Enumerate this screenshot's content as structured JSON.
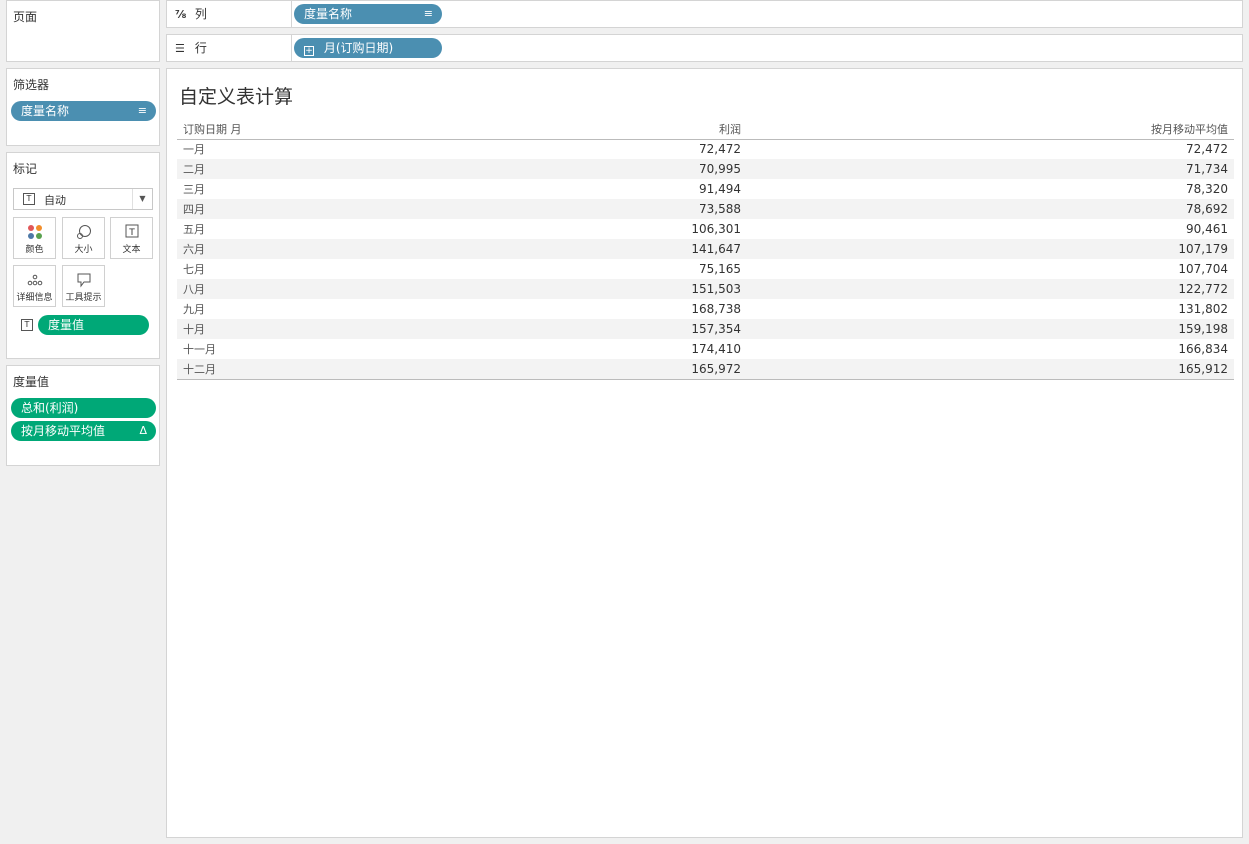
{
  "pages": {
    "title": "页面"
  },
  "columns_shelf": {
    "label": "列",
    "icon": "columns-icon",
    "pill": "度量名称"
  },
  "rows_shelf": {
    "label": "行",
    "icon": "rows-icon",
    "pill": "月(订购日期)"
  },
  "filters": {
    "title": "筛选器",
    "pill": "度量名称"
  },
  "marks": {
    "title": "标记",
    "mark_type": "自动",
    "buttons": {
      "color": "颜色",
      "size": "大小",
      "text": "文本",
      "detail": "详细信息",
      "tooltip": "工具提示"
    },
    "text_pill": "度量值"
  },
  "measure_values": {
    "title": "度量值",
    "items": [
      "总和(利润)",
      "按月移动平均值"
    ]
  },
  "view": {
    "title": "自定义表计算",
    "headers": [
      "订购日期 月",
      "利润",
      "按月移动平均值"
    ],
    "rows": [
      [
        "一月",
        "72,472",
        "72,472"
      ],
      [
        "二月",
        "70,995",
        "71,734"
      ],
      [
        "三月",
        "91,494",
        "78,320"
      ],
      [
        "四月",
        "73,588",
        "78,692"
      ],
      [
        "五月",
        "106,301",
        "90,461"
      ],
      [
        "六月",
        "141,647",
        "107,179"
      ],
      [
        "七月",
        "75,165",
        "107,704"
      ],
      [
        "八月",
        "151,503",
        "122,772"
      ],
      [
        "九月",
        "168,738",
        "131,802"
      ],
      [
        "十月",
        "157,354",
        "159,198"
      ],
      [
        "十一月",
        "174,410",
        "166,834"
      ],
      [
        "十二月",
        "165,972",
        "165,912"
      ]
    ]
  },
  "colors": {
    "dimension_pill": "#4b8fb1",
    "measure_pill": "#00a877"
  }
}
